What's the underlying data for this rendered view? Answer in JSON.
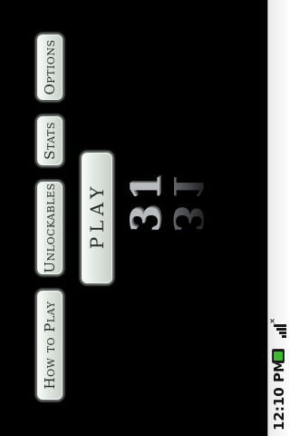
{
  "status_bar": {
    "time": "12:10 PM",
    "icons": [
      "battery-charging-icon",
      "signal-icon"
    ]
  },
  "logo": {
    "text": "31"
  },
  "menu": {
    "play_label": "PLAY",
    "options_label": "Options",
    "stats_label": "Stats",
    "unlockables_label": "Unlockables",
    "how_to_play_label": "How to Play"
  },
  "colors": {
    "background": "#000000",
    "button_face": "#dfe6df",
    "button_border": "#5b615c",
    "button_text": "#243029",
    "status_bar": "#f2f2f2"
  }
}
